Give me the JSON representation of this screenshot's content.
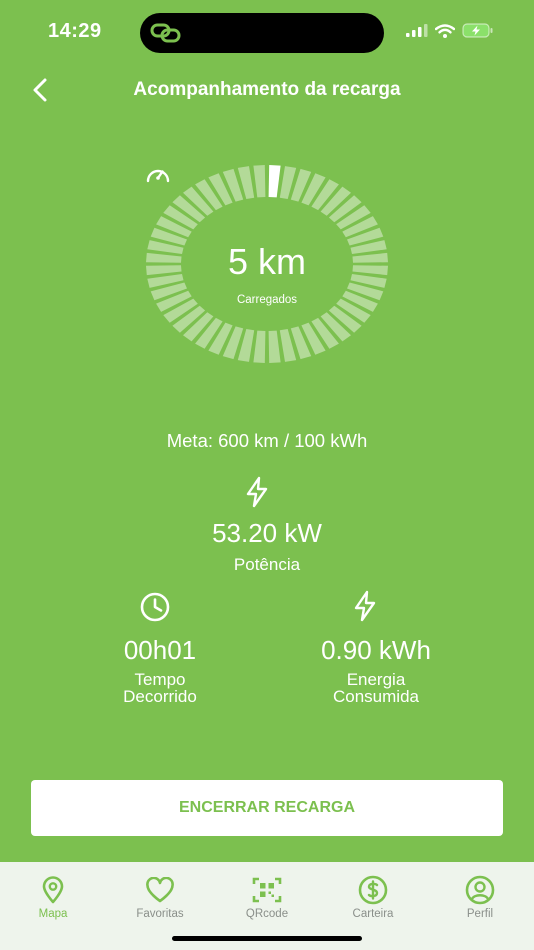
{
  "status_bar": {
    "time": "14:29",
    "battery_color": "#8be06a"
  },
  "header": {
    "title": "Acompanhamento da recarga",
    "back_icon": "chevron-left-icon"
  },
  "gauge": {
    "value": "5 km",
    "label": "Carregados",
    "progress_fraction": 0.01,
    "icon": "speedometer-icon"
  },
  "meta": {
    "text": "Meta: 600 km / 100 kWh"
  },
  "stats": {
    "power": {
      "value": "53.20 kW",
      "label": "Potência",
      "icon": "lightning-icon"
    },
    "time": {
      "value": "00h01",
      "label_line1": "Tempo",
      "label_line2": "Decorrido",
      "icon": "clock-icon"
    },
    "energy": {
      "value": "0.90 kWh",
      "label_line1": "Energia",
      "label_line2": "Consumida",
      "icon": "lightning-icon"
    }
  },
  "actions": {
    "end_charge_label": "ENCERRAR RECARGA"
  },
  "tab_bar": {
    "items": [
      {
        "label": "Mapa",
        "icon": "map-pin-icon",
        "active": true
      },
      {
        "label": "Favoritas",
        "icon": "heart-icon",
        "active": false
      },
      {
        "label": "QRcode",
        "icon": "qrcode-icon",
        "active": false
      },
      {
        "label": "Carteira",
        "icon": "dollar-icon",
        "active": false
      },
      {
        "label": "Perfil",
        "icon": "user-icon",
        "active": false
      }
    ]
  },
  "colors": {
    "brand_green": "#7cc04f",
    "tab_bar_bg": "#eef4ec",
    "inactive_tab": "#8a8f8a"
  }
}
